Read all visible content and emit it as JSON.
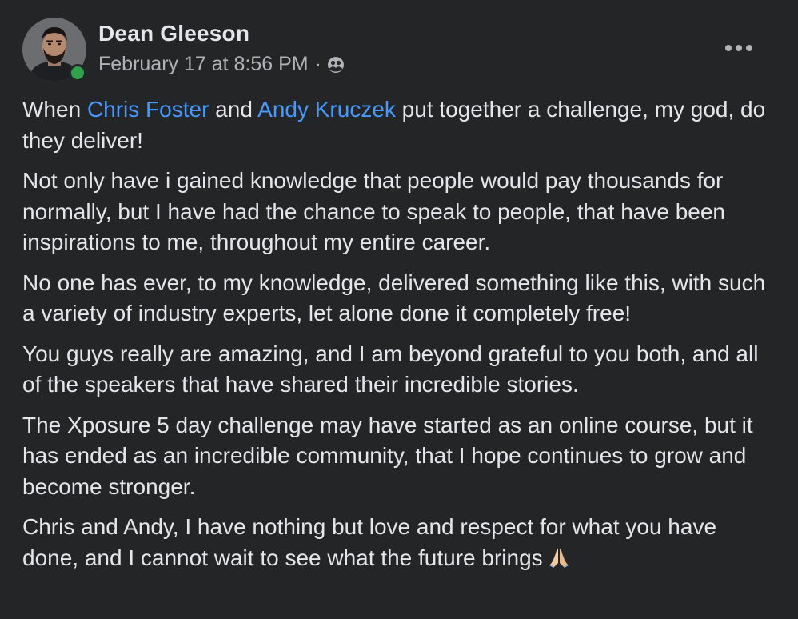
{
  "author": {
    "name": "Dean Gleeson",
    "online": true
  },
  "meta": {
    "timestamp": "February 17 at 8:56 PM",
    "separator": "·",
    "privacy_icon": "friends-icon"
  },
  "menu": {
    "icon": "more-horizontal-icon"
  },
  "paragraphs": {
    "p1": {
      "before": "When ",
      "mention1": "Chris Foster",
      "middle": " and ",
      "mention2": "Andy Kruczek",
      "after": " put together a challenge, my god, do they deliver!"
    },
    "p2": "Not only have i gained knowledge that people would pay thousands for normally, but I have had the chance to speak to people, that have been inspirations to me, throughout my entire career.",
    "p3": "No one has ever, to my knowledge, delivered something like this, with such a variety of industry experts, let alone done it completely free!",
    "p4": "You guys really are amazing, and I am beyond grateful to you both, and all of the speakers that have shared their incredible stories.",
    "p5": "The Xposure 5 day challenge may have started as an online course, but it has ended as an incredible community, that I hope continues to grow and become stronger.",
    "p6": "Chris and Andy, I have nothing but love and respect for what you have done, and I cannot wait to see what the future brings",
    "p6_emoji": "folded-hands-icon"
  },
  "colors": {
    "background": "#242526",
    "text": "#e4e6eb",
    "secondary_text": "#b0b3b8",
    "mention": "#4599ff",
    "online": "#31a24c"
  }
}
